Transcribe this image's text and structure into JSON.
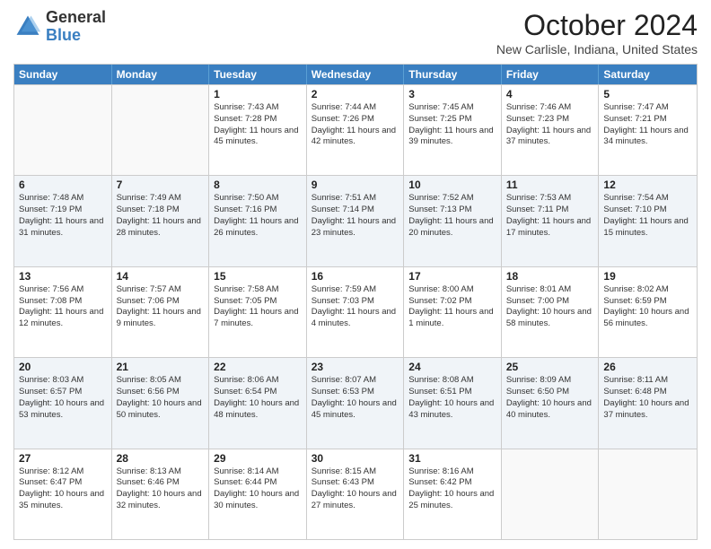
{
  "logo": {
    "general": "General",
    "blue": "Blue"
  },
  "header": {
    "month": "October 2024",
    "location": "New Carlisle, Indiana, United States"
  },
  "days": [
    "Sunday",
    "Monday",
    "Tuesday",
    "Wednesday",
    "Thursday",
    "Friday",
    "Saturday"
  ],
  "weeks": [
    [
      {
        "day": "",
        "sunrise": "",
        "sunset": "",
        "daylight": ""
      },
      {
        "day": "",
        "sunrise": "",
        "sunset": "",
        "daylight": ""
      },
      {
        "day": "1",
        "sunrise": "Sunrise: 7:43 AM",
        "sunset": "Sunset: 7:28 PM",
        "daylight": "Daylight: 11 hours and 45 minutes."
      },
      {
        "day": "2",
        "sunrise": "Sunrise: 7:44 AM",
        "sunset": "Sunset: 7:26 PM",
        "daylight": "Daylight: 11 hours and 42 minutes."
      },
      {
        "day": "3",
        "sunrise": "Sunrise: 7:45 AM",
        "sunset": "Sunset: 7:25 PM",
        "daylight": "Daylight: 11 hours and 39 minutes."
      },
      {
        "day": "4",
        "sunrise": "Sunrise: 7:46 AM",
        "sunset": "Sunset: 7:23 PM",
        "daylight": "Daylight: 11 hours and 37 minutes."
      },
      {
        "day": "5",
        "sunrise": "Sunrise: 7:47 AM",
        "sunset": "Sunset: 7:21 PM",
        "daylight": "Daylight: 11 hours and 34 minutes."
      }
    ],
    [
      {
        "day": "6",
        "sunrise": "Sunrise: 7:48 AM",
        "sunset": "Sunset: 7:19 PM",
        "daylight": "Daylight: 11 hours and 31 minutes."
      },
      {
        "day": "7",
        "sunrise": "Sunrise: 7:49 AM",
        "sunset": "Sunset: 7:18 PM",
        "daylight": "Daylight: 11 hours and 28 minutes."
      },
      {
        "day": "8",
        "sunrise": "Sunrise: 7:50 AM",
        "sunset": "Sunset: 7:16 PM",
        "daylight": "Daylight: 11 hours and 26 minutes."
      },
      {
        "day": "9",
        "sunrise": "Sunrise: 7:51 AM",
        "sunset": "Sunset: 7:14 PM",
        "daylight": "Daylight: 11 hours and 23 minutes."
      },
      {
        "day": "10",
        "sunrise": "Sunrise: 7:52 AM",
        "sunset": "Sunset: 7:13 PM",
        "daylight": "Daylight: 11 hours and 20 minutes."
      },
      {
        "day": "11",
        "sunrise": "Sunrise: 7:53 AM",
        "sunset": "Sunset: 7:11 PM",
        "daylight": "Daylight: 11 hours and 17 minutes."
      },
      {
        "day": "12",
        "sunrise": "Sunrise: 7:54 AM",
        "sunset": "Sunset: 7:10 PM",
        "daylight": "Daylight: 11 hours and 15 minutes."
      }
    ],
    [
      {
        "day": "13",
        "sunrise": "Sunrise: 7:56 AM",
        "sunset": "Sunset: 7:08 PM",
        "daylight": "Daylight: 11 hours and 12 minutes."
      },
      {
        "day": "14",
        "sunrise": "Sunrise: 7:57 AM",
        "sunset": "Sunset: 7:06 PM",
        "daylight": "Daylight: 11 hours and 9 minutes."
      },
      {
        "day": "15",
        "sunrise": "Sunrise: 7:58 AM",
        "sunset": "Sunset: 7:05 PM",
        "daylight": "Daylight: 11 hours and 7 minutes."
      },
      {
        "day": "16",
        "sunrise": "Sunrise: 7:59 AM",
        "sunset": "Sunset: 7:03 PM",
        "daylight": "Daylight: 11 hours and 4 minutes."
      },
      {
        "day": "17",
        "sunrise": "Sunrise: 8:00 AM",
        "sunset": "Sunset: 7:02 PM",
        "daylight": "Daylight: 11 hours and 1 minute."
      },
      {
        "day": "18",
        "sunrise": "Sunrise: 8:01 AM",
        "sunset": "Sunset: 7:00 PM",
        "daylight": "Daylight: 10 hours and 58 minutes."
      },
      {
        "day": "19",
        "sunrise": "Sunrise: 8:02 AM",
        "sunset": "Sunset: 6:59 PM",
        "daylight": "Daylight: 10 hours and 56 minutes."
      }
    ],
    [
      {
        "day": "20",
        "sunrise": "Sunrise: 8:03 AM",
        "sunset": "Sunset: 6:57 PM",
        "daylight": "Daylight: 10 hours and 53 minutes."
      },
      {
        "day": "21",
        "sunrise": "Sunrise: 8:05 AM",
        "sunset": "Sunset: 6:56 PM",
        "daylight": "Daylight: 10 hours and 50 minutes."
      },
      {
        "day": "22",
        "sunrise": "Sunrise: 8:06 AM",
        "sunset": "Sunset: 6:54 PM",
        "daylight": "Daylight: 10 hours and 48 minutes."
      },
      {
        "day": "23",
        "sunrise": "Sunrise: 8:07 AM",
        "sunset": "Sunset: 6:53 PM",
        "daylight": "Daylight: 10 hours and 45 minutes."
      },
      {
        "day": "24",
        "sunrise": "Sunrise: 8:08 AM",
        "sunset": "Sunset: 6:51 PM",
        "daylight": "Daylight: 10 hours and 43 minutes."
      },
      {
        "day": "25",
        "sunrise": "Sunrise: 8:09 AM",
        "sunset": "Sunset: 6:50 PM",
        "daylight": "Daylight: 10 hours and 40 minutes."
      },
      {
        "day": "26",
        "sunrise": "Sunrise: 8:11 AM",
        "sunset": "Sunset: 6:48 PM",
        "daylight": "Daylight: 10 hours and 37 minutes."
      }
    ],
    [
      {
        "day": "27",
        "sunrise": "Sunrise: 8:12 AM",
        "sunset": "Sunset: 6:47 PM",
        "daylight": "Daylight: 10 hours and 35 minutes."
      },
      {
        "day": "28",
        "sunrise": "Sunrise: 8:13 AM",
        "sunset": "Sunset: 6:46 PM",
        "daylight": "Daylight: 10 hours and 32 minutes."
      },
      {
        "day": "29",
        "sunrise": "Sunrise: 8:14 AM",
        "sunset": "Sunset: 6:44 PM",
        "daylight": "Daylight: 10 hours and 30 minutes."
      },
      {
        "day": "30",
        "sunrise": "Sunrise: 8:15 AM",
        "sunset": "Sunset: 6:43 PM",
        "daylight": "Daylight: 10 hours and 27 minutes."
      },
      {
        "day": "31",
        "sunrise": "Sunrise: 8:16 AM",
        "sunset": "Sunset: 6:42 PM",
        "daylight": "Daylight: 10 hours and 25 minutes."
      },
      {
        "day": "",
        "sunrise": "",
        "sunset": "",
        "daylight": ""
      },
      {
        "day": "",
        "sunrise": "",
        "sunset": "",
        "daylight": ""
      }
    ]
  ]
}
